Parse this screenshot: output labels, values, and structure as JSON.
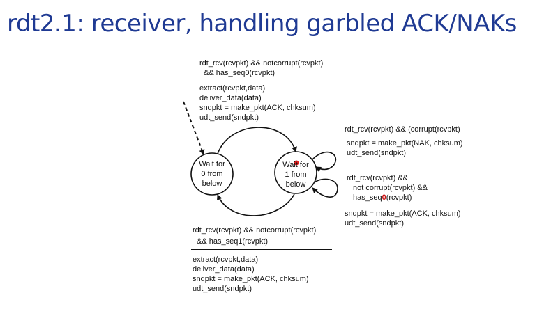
{
  "title": "rdt2.1: receiver, handling garbled ACK/NAKs",
  "states": {
    "wait0": [
      "Wait for",
      "0 from",
      "below"
    ],
    "wait1": [
      "Wait for",
      "1 from",
      "below"
    ]
  },
  "transitions": {
    "top": {
      "event": [
        "rdt_rcv(rcvpkt) && notcorrupt(rcvpkt)",
        "&& has_seq0(rcvpkt)"
      ],
      "actions": [
        "extract(rcvpkt,data)",
        "deliver_data(data)",
        "sndpkt = make_pkt(ACK, chksum)",
        "udt_send(sndpkt)"
      ]
    },
    "right_corrupt": {
      "event": "rdt_rcv(rcvpkt) && (corrupt(rcvpkt)",
      "actions": [
        "sndpkt = make_pkt(NAK, chksum)",
        "udt_send(sndpkt)"
      ]
    },
    "right_dup": {
      "event_line1": "rdt_rcv(rcvpkt) &&",
      "event_line2": "not corrupt(rcvpkt) &&",
      "event_line3_prefix": "has_seq",
      "event_line3_highlight": "0",
      "event_line3_suffix": "(rcvpkt)",
      "actions": [
        "sndpkt = make_pkt(ACK, chksum)",
        "udt_send(sndpkt)"
      ]
    },
    "bottom": {
      "event": [
        "rdt_rcv(rcvpkt) && notcorrupt(rcvpkt)",
        "&& has_seq1(rcvpkt)"
      ],
      "actions": [
        "extract(rcvpkt,data)",
        "deliver_data(data)",
        "sndpkt = make_pkt(ACK, chksum)",
        "udt_send(sndpkt)"
      ]
    }
  },
  "colors": {
    "title": "#1f3a93",
    "highlight": "#cc1111"
  }
}
